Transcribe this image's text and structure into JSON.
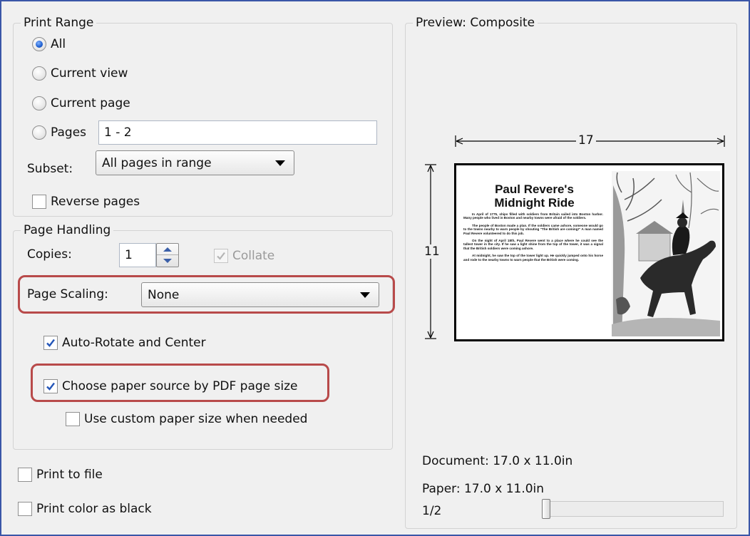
{
  "print_range": {
    "legend": "Print Range",
    "all_label": "All",
    "current_view_label": "Current view",
    "current_page_label": "Current page",
    "pages_label": "Pages",
    "pages_value": "1 - 2",
    "subset_label": "Subset:",
    "subset_value": "All pages in range",
    "reverse_label": "Reverse pages",
    "selected": "All",
    "reverse_checked": false
  },
  "page_handling": {
    "legend": "Page Handling",
    "copies_label": "Copies:",
    "copies_value": "1",
    "collate_label": "Collate",
    "collate_checked": true,
    "collate_enabled": false,
    "scaling_label": "Page Scaling:",
    "scaling_value": "None",
    "auto_rotate_label": "Auto-Rotate and Center",
    "auto_rotate_checked": true,
    "paper_source_label": "Choose paper source by PDF page size",
    "paper_source_checked": true,
    "custom_paper_label": "Use custom paper size when needed",
    "custom_paper_checked": false
  },
  "output": {
    "print_to_file_label": "Print to file",
    "print_to_file_checked": false,
    "color_black_label": "Print color as black",
    "color_black_checked": false
  },
  "preview": {
    "legend": "Preview: Composite",
    "width_dim": "17",
    "height_dim": "11",
    "document_info": "Document: 17.0 x 11.0in",
    "paper_info": "Paper: 17.0 x 11.0in",
    "page_counter": "1/2",
    "page_slider_position": 0
  },
  "article": {
    "title_line1": "Paul Revere's",
    "title_line2": "Midnight Ride",
    "paragraphs": [
      "In April of 1775, ships filled with soldiers from Britain sailed into Boston harbor. Many people who lived in Boston and nearby towns were afraid of the soldiers.",
      "The people of Boston made a plan. If the soldiers came ashore, someone would go to the towns nearby to warn people by shouting \"The British are coming!\" A man named Paul Revere volunteered to do this job.",
      "On the night of April 18th, Paul Revere went to a place where he could see the tallest tower in the city. If he saw a light shine from the top of the tower, it was a signal that the British soldiers were coming ashore.",
      "At midnight, he saw the top of the tower light up. He quickly jumped onto his horse and rode to the nearby towns to warn people that the British were coming."
    ]
  },
  "colors": {
    "highlight": "#b84a4a",
    "frame": "#3a56a8",
    "check": "#2456b8"
  }
}
